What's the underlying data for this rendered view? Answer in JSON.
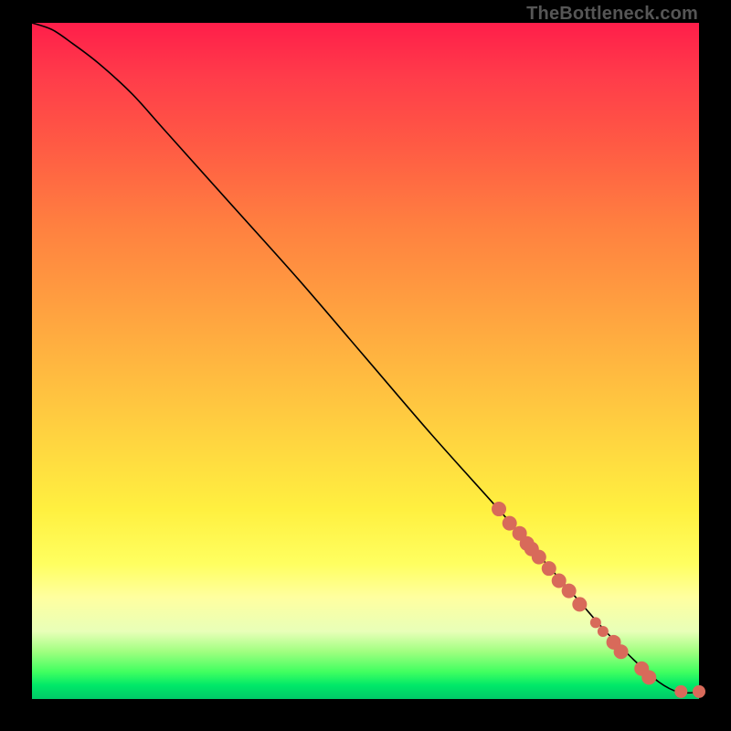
{
  "watermark": "TheBottleneck.com",
  "chart_data": {
    "type": "line",
    "title": "",
    "xlabel": "",
    "ylabel": "",
    "xlim": [
      0,
      100
    ],
    "ylim": [
      0,
      100
    ],
    "grid": false,
    "legend": false,
    "series": [
      {
        "name": "curve",
        "x": [
          0,
          3,
          6,
          10,
          15,
          20,
          30,
          40,
          50,
          60,
          70,
          78,
          82,
          86,
          90,
          94,
          97,
          100
        ],
        "y": [
          100,
          99,
          97,
          94,
          89.5,
          84,
          73,
          62,
          50.5,
          39,
          28,
          19,
          14.5,
          10,
          6,
          2.5,
          1,
          1
        ]
      }
    ],
    "markers": {
      "name": "dots",
      "x": [
        70.0,
        71.6,
        73.1,
        74.2,
        74.9,
        76.0,
        77.5,
        79.0,
        80.5,
        82.1,
        84.5,
        85.6,
        87.2,
        88.3,
        91.4,
        92.5,
        97.3,
        100.0
      ],
      "y": [
        28.1,
        26.0,
        24.5,
        23.0,
        22.2,
        21.0,
        19.3,
        17.5,
        16.0,
        14.0,
        11.3,
        10.0,
        8.4,
        7.0,
        4.5,
        3.2,
        1.1,
        1.1
      ],
      "r": [
        8,
        8,
        8,
        8,
        8,
        8,
        8,
        8,
        8,
        8,
        6,
        6,
        8,
        8,
        8,
        8,
        7,
        7
      ]
    }
  }
}
